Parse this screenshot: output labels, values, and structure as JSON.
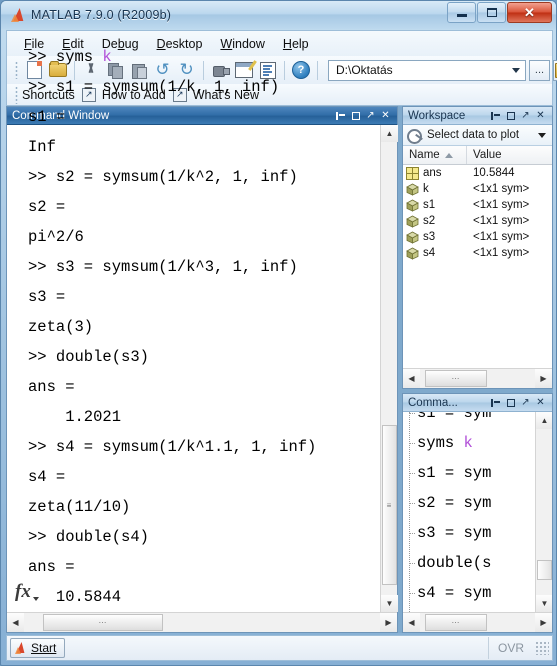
{
  "window": {
    "title": "MATLAB  7.9.0 (R2009b)",
    "logo_icon": "matlab-logo-icon",
    "minimize_label": "Minimize",
    "maximize_label": "Maximize",
    "close_label": "Close"
  },
  "menubar": {
    "items": [
      {
        "label": "File",
        "accel": "F"
      },
      {
        "label": "Edit",
        "accel": "E"
      },
      {
        "label": "Debug",
        "accel": "b"
      },
      {
        "label": "Desktop",
        "accel": "D"
      },
      {
        "label": "Window",
        "accel": "W"
      },
      {
        "label": "Help",
        "accel": "H"
      }
    ]
  },
  "toolbar": {
    "buttons": [
      {
        "name": "new-file-icon",
        "title": "New File"
      },
      {
        "name": "open-file-icon",
        "title": "Open File"
      },
      {
        "name": "cut-icon",
        "title": "Cut"
      },
      {
        "name": "copy-icon",
        "title": "Copy"
      },
      {
        "name": "paste-icon",
        "title": "Paste"
      },
      {
        "name": "undo-icon",
        "title": "Undo"
      },
      {
        "name": "redo-icon",
        "title": "Redo"
      },
      {
        "name": "simulink-icon",
        "title": "Simulink Library"
      },
      {
        "name": "guide-icon",
        "title": "GUIDE"
      },
      {
        "name": "profiler-icon",
        "title": "Profiler"
      },
      {
        "name": "help-icon",
        "title": "Help"
      }
    ],
    "path": {
      "value": "D:\\Oktatás",
      "placeholder": "Current Folder",
      "browse_label": "...",
      "up_label": "Go Up One Level"
    }
  },
  "shortcuts_bar": {
    "items": [
      {
        "label": "Shortcuts",
        "has_arrow": false
      },
      {
        "label": "How to Add",
        "has_arrow": true
      },
      {
        "label": "What's New",
        "has_arrow": true
      }
    ]
  },
  "command_window": {
    "title": "Command Window",
    "dock_buttons": [
      "dock-left-icon",
      "maximize-icon",
      "undock-icon",
      "close-icon"
    ],
    "fx_label": "fx",
    "lines": [
      {
        "prompt": ">> ",
        "text": "syms ",
        "sym": "k"
      },
      {
        "prompt": ">> ",
        "text": "s1 = symsum(1/k, 1, inf)",
        "sym": ""
      },
      {
        "prompt": "",
        "text": "s1 =",
        "sym": ""
      },
      {
        "prompt": "",
        "text": "Inf",
        "sym": ""
      },
      {
        "prompt": ">> ",
        "text": "s2 = symsum(1/k^2, 1, inf)",
        "sym": ""
      },
      {
        "prompt": "",
        "text": "s2 =",
        "sym": ""
      },
      {
        "prompt": "",
        "text": "pi^2/6",
        "sym": ""
      },
      {
        "prompt": ">> ",
        "text": "s3 = symsum(1/k^3, 1, inf)",
        "sym": ""
      },
      {
        "prompt": "",
        "text": "s3 =",
        "sym": ""
      },
      {
        "prompt": "",
        "text": "zeta(3)",
        "sym": ""
      },
      {
        "prompt": ">> ",
        "text": "double(s3)",
        "sym": ""
      },
      {
        "prompt": "",
        "text": "ans =",
        "sym": ""
      },
      {
        "prompt": "",
        "text": "    1.2021",
        "sym": ""
      },
      {
        "prompt": ">> ",
        "text": "s4 = symsum(1/k^1.1, 1, inf)",
        "sym": ""
      },
      {
        "prompt": "",
        "text": "s4 =",
        "sym": ""
      },
      {
        "prompt": "",
        "text": "zeta(11/10)",
        "sym": ""
      },
      {
        "prompt": ">> ",
        "text": "double(s4)",
        "sym": ""
      },
      {
        "prompt": "",
        "text": "ans =",
        "sym": ""
      },
      {
        "prompt": "",
        "text": "   10.5844",
        "sym": ""
      }
    ]
  },
  "workspace": {
    "title": "Workspace",
    "dock_buttons": [
      "dock-left-icon",
      "maximize-icon",
      "undock-icon",
      "close-icon"
    ],
    "plot_selector_label": "Select data to plot",
    "columns": [
      "Name",
      "Value"
    ],
    "sort_column": "Name",
    "sort_direction": "ascending",
    "rows": [
      {
        "icon": "matrix-icon",
        "name": "ans",
        "value": "10.5844"
      },
      {
        "icon": "cube-icon",
        "name": "k",
        "value": "<1x1 sym>"
      },
      {
        "icon": "cube-icon",
        "name": "s1",
        "value": "<1x1 sym>"
      },
      {
        "icon": "cube-icon",
        "name": "s2",
        "value": "<1x1 sym>"
      },
      {
        "icon": "cube-icon",
        "name": "s3",
        "value": "<1x1 sym>"
      },
      {
        "icon": "cube-icon",
        "name": "s4",
        "value": "<1x1 sym>"
      }
    ]
  },
  "command_history": {
    "title": "Comma...",
    "dock_buttons": [
      "dock-left-icon",
      "maximize-icon",
      "undock-icon",
      "close-icon"
    ],
    "lines": [
      "s1 = sym",
      "syms k",
      "s1 = sym",
      "s2 = sym",
      "s3 = sym",
      "double(s",
      "s4 = sym",
      "double(s"
    ]
  },
  "statusbar": {
    "start_label": "Start",
    "overwrite_label": "OVR"
  },
  "colors": {
    "accent": "#2f6ca6",
    "symbol_highlight": "#b14fd8",
    "desktop_bg": "#7fa9cc",
    "title_close": "#bf2f13"
  }
}
